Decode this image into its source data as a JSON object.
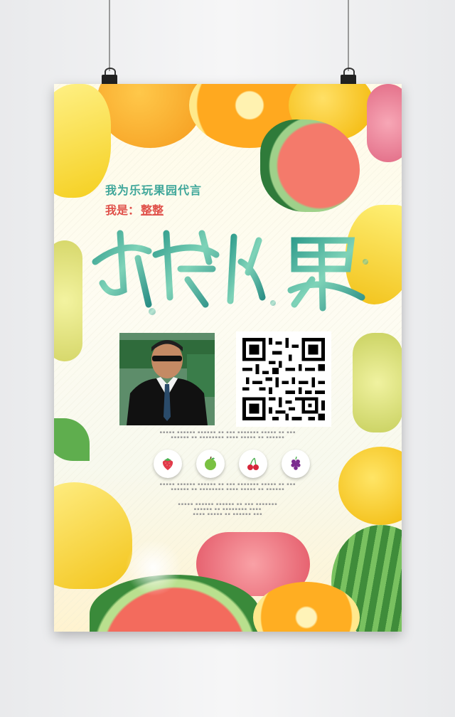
{
  "poster": {
    "tagline": "我为乐玩果园代言",
    "me_label": "我是：",
    "me_name": "整整",
    "title_art": "新鲜水果",
    "fruit_icons": [
      "strawberry-icon",
      "apple-icon",
      "cherry-icon",
      "grape-icon"
    ],
    "colors": {
      "accent_green": "#3fa79a",
      "accent_red": "#e0524b"
    }
  }
}
